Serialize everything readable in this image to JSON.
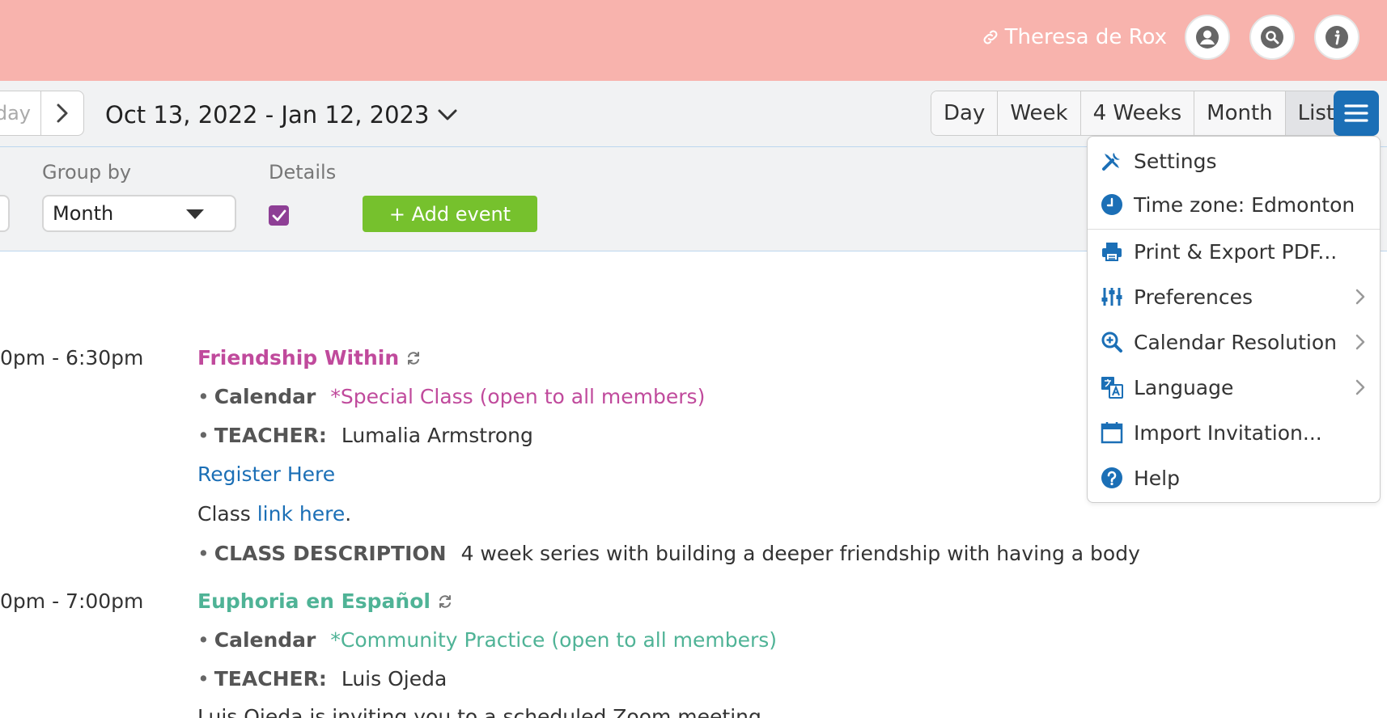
{
  "header": {
    "user_name": "Theresa de Rox",
    "icons": [
      "link-icon",
      "user-icon",
      "search-icon",
      "info-icon"
    ],
    "background": "#f8b3ad"
  },
  "toolbar": {
    "today_label": "day",
    "date_range": "Oct 13, 2022 - Jan 12, 2023",
    "views": [
      "Day",
      "Week",
      "4 Weeks",
      "Month",
      "List"
    ],
    "active_view": "List",
    "menu_color": "#1b6fb6"
  },
  "filters": {
    "group_by_label": "Group by",
    "group_by_value": "Month",
    "details_label": "Details",
    "details_checked": true,
    "add_event_label": "+ Add event",
    "add_event_color": "#76c12d"
  },
  "events": [
    {
      "time": "0pm - 6:30pm",
      "title": "Friendship Within",
      "color": "#c04a9c",
      "calendar_label": "Calendar",
      "calendar_value": "*Special Class (open to all members)",
      "teacher_label": "TEACHER:",
      "teacher_value": "Lumalia Armstrong",
      "register_link": "Register Here",
      "class_text": "Class",
      "class_link": "link here",
      "class_period": ".",
      "description_label": "CLASS DESCRIPTION",
      "description_value": "4 week series with building a deeper  friendship with having a body"
    },
    {
      "time": "0pm - 7:00pm",
      "title": "Euphoria en Español",
      "color": "#4fb396",
      "calendar_label": "Calendar",
      "calendar_value": "*Community Practice (open to all members)",
      "teacher_label": "TEACHER:",
      "teacher_value": "Luis Ojeda",
      "partial_text": "Luis Ojeda is inviting you to a scheduled Zoom meeting."
    }
  ],
  "menu": {
    "items": [
      {
        "label": "Settings",
        "icon": "tools-icon"
      },
      {
        "label": "Time zone: Edmonton",
        "icon": "clock-icon"
      },
      {
        "label": "Print & Export PDF...",
        "icon": "printer-icon"
      },
      {
        "label": "Preferences",
        "icon": "sliders-icon",
        "submenu": true
      },
      {
        "label": "Calendar Resolution",
        "icon": "zoom-in-icon",
        "submenu": true
      },
      {
        "label": "Language",
        "icon": "translate-icon",
        "submenu": true
      },
      {
        "label": "Import Invitation...",
        "icon": "calendar-icon"
      },
      {
        "label": "Help",
        "icon": "help-icon"
      }
    ]
  }
}
